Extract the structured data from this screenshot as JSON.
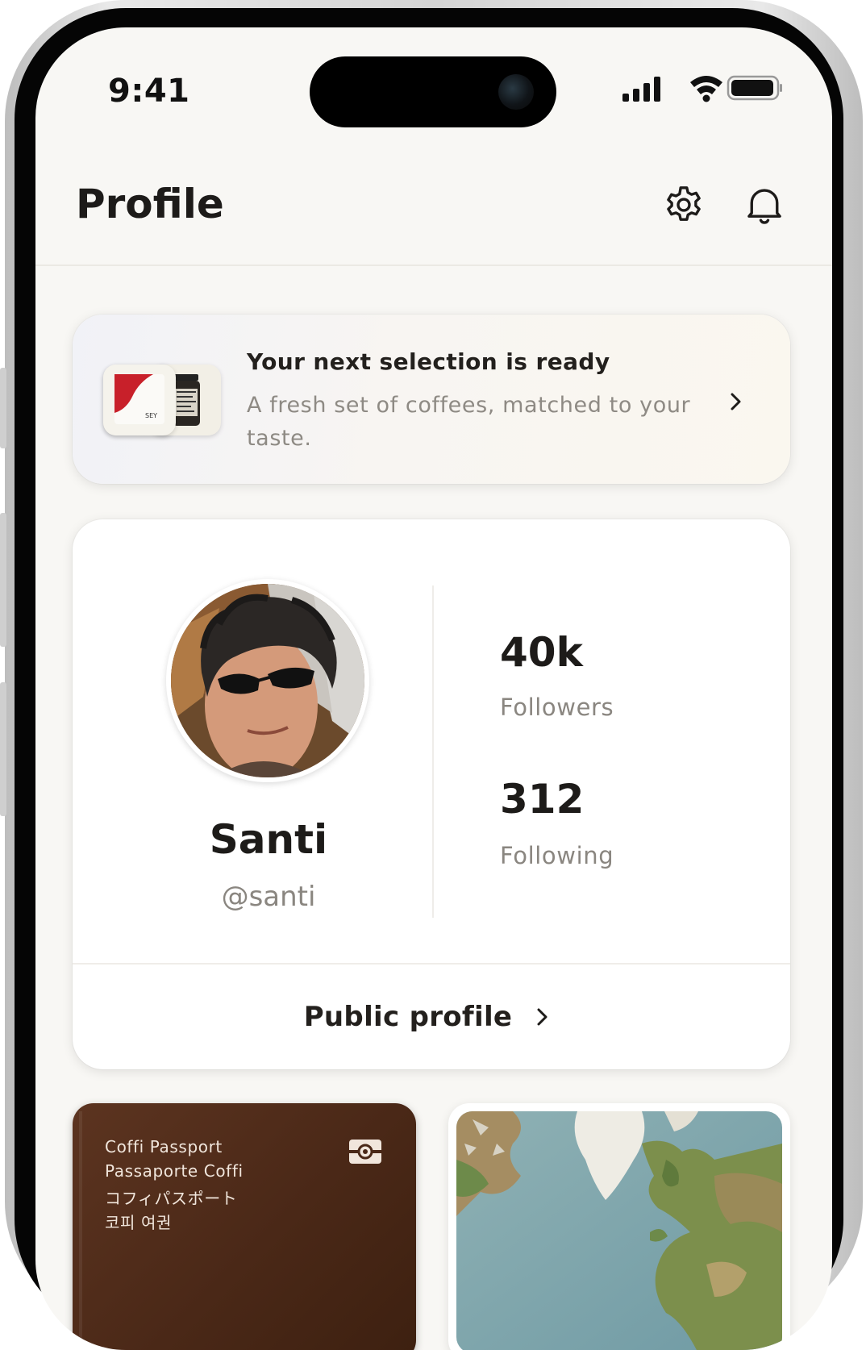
{
  "status_bar": {
    "time": "9:41"
  },
  "header": {
    "title": "Profile",
    "settings_icon": "gear-icon",
    "notifications_icon": "bell-icon"
  },
  "banner": {
    "title": "Your next selection is ready",
    "subtitle": "A fresh set of coffees, matched to your taste.",
    "thumb_label": "SEY"
  },
  "profile": {
    "name": "Santi",
    "handle": "@santi",
    "followers_count": "40k",
    "followers_label": "Followers",
    "following_count": "312",
    "following_label": "Following",
    "public_profile_label": "Public profile"
  },
  "passport": {
    "lines": [
      "Coffi Passport",
      "Passaporte Coffi",
      "コフィパスポート",
      "코피 여권"
    ]
  },
  "colors": {
    "background": "#f8f7f4",
    "card": "#ffffff",
    "text_primary": "#1d1b19",
    "text_secondary": "#8a8680",
    "passport_leather": "#4a2817"
  }
}
